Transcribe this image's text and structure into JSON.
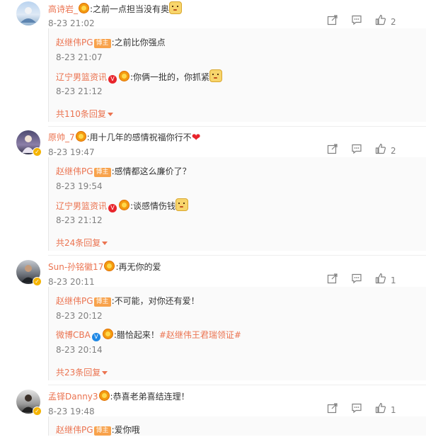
{
  "colors": {
    "link": "#eb7350",
    "muted": "#808080",
    "text": "#333333"
  },
  "comments": [
    {
      "user": "高诗岩_",
      "text": ":之前一点担当没有奥",
      "time": "8-23 21:02",
      "likes": "2",
      "replies": [
        {
          "user": "赵继伟PG",
          "badge": "博主",
          "text": ":之前比你强点",
          "time": "8-23 21:07"
        },
        {
          "user": "辽宁男篮资讯",
          "text": ":你俩一批的，你抓紧",
          "time": "8-23 21:12"
        }
      ],
      "more": "共110条回复"
    },
    {
      "user": "原帅_7",
      "text": ":用十几年的感情祝福你行不",
      "time": "8-23 19:47",
      "likes": "2",
      "replies": [
        {
          "user": "赵继伟PG",
          "badge": "博主",
          "text": ":感情都这么廉价了？",
          "time": "8-23 19:54"
        },
        {
          "user": "辽宁男篮资讯",
          "text": ":谈感情伤钱",
          "time": "8-23 21:12"
        }
      ],
      "more": "共24条回复"
    },
    {
      "user": "Sun-孙铭徽17",
      "text": ":再无你的爱",
      "time": "8-23 20:11",
      "likes": "1",
      "replies": [
        {
          "user": "赵继伟PG",
          "badge": "博主",
          "text": ":不可能，对你还有爱！",
          "time": "8-23 20:12"
        },
        {
          "user": "微博CBA",
          "text": ":腊恰起来！",
          "hashtag": "#赵继伟王君瑞领证#",
          "time": "8-23 20:14"
        }
      ],
      "more": "共23条回复"
    },
    {
      "user": "孟铎Danny3",
      "text": ":恭喜老弟喜结连理！",
      "time": "8-23 19:48",
      "likes": "1",
      "replies": [
        {
          "user": "赵继伟PG",
          "badge": "博主",
          "text": ":爱你哦"
        }
      ]
    }
  ]
}
